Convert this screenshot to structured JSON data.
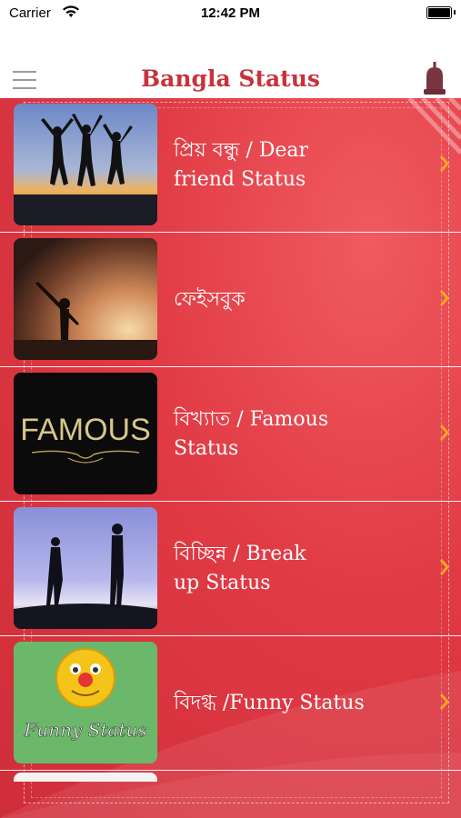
{
  "status_bar": {
    "carrier": "Carrier",
    "time": "12:42 PM"
  },
  "nav": {
    "title": "Bangla Status",
    "menu_icon": "hamburger-menu-icon",
    "bell_icon": "bell-icon"
  },
  "colors": {
    "title": "#c8323c",
    "list_background": "#e03a44",
    "chevron": "#f5a623",
    "bell": "#8b3a3a"
  },
  "items": [
    {
      "line1": "প্রিয় বন্ধু  / Dear",
      "line2": "friend Status",
      "image": "friends-jumping-silhouette"
    },
    {
      "line1": "ফেইসবুক",
      "line2": "",
      "image": "person-silhouette-sunset"
    },
    {
      "line1": "বিখ্যাত / Famous",
      "line2": "Status",
      "image": "famous-text-logo",
      "image_text": "FAMOUS"
    },
    {
      "line1": "বিচ্ছিন্ন / Break",
      "line2": "up Status",
      "image": "couple-silhouette-breakup"
    },
    {
      "line1": "বিদগ্ধ /Funny Status",
      "line2": "",
      "image": "funny-emoji",
      "image_text": "Funny Status"
    }
  ]
}
